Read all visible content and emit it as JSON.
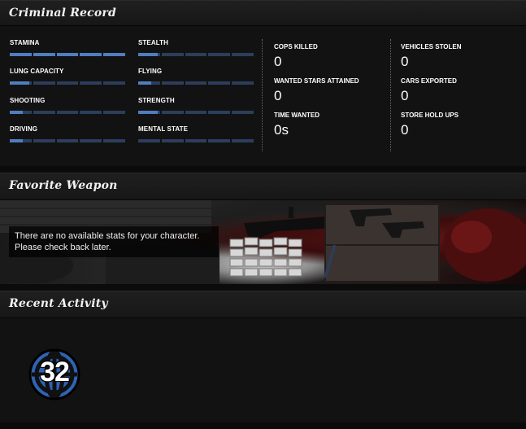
{
  "criminal_record": {
    "title": "Criminal Record",
    "skills": [
      {
        "label": "STAMINA",
        "level": 1.0
      },
      {
        "label": "STEALTH",
        "level": 0.18
      },
      {
        "label": "LUNG CAPACITY",
        "level": 0.18
      },
      {
        "label": "FLYING",
        "level": 0.12
      },
      {
        "label": "SHOOTING",
        "level": 0.12
      },
      {
        "label": "STRENGTH",
        "level": 0.18
      },
      {
        "label": "DRIVING",
        "level": 0.12
      },
      {
        "label": "MENTAL STATE",
        "level": 0.0
      }
    ],
    "stats": [
      {
        "label": "COPS KILLED",
        "value": "0"
      },
      {
        "label": "WANTED STARS ATTAINED",
        "value": "0"
      },
      {
        "label": "TIME WANTED",
        "value": "0s"
      },
      {
        "label": "VEHICLES STOLEN",
        "value": "0"
      },
      {
        "label": "CARS EXPORTED",
        "value": "0"
      },
      {
        "label": "STORE HOLD UPS",
        "value": "0"
      }
    ]
  },
  "favorite_weapon": {
    "title": "Favorite Weapon",
    "message_line1": "There are no available stats for your character.",
    "message_line2": "Please check back later."
  },
  "recent_activity": {
    "title": "Recent Activity",
    "rank": "32",
    "rank_color": "#2f63b5"
  }
}
